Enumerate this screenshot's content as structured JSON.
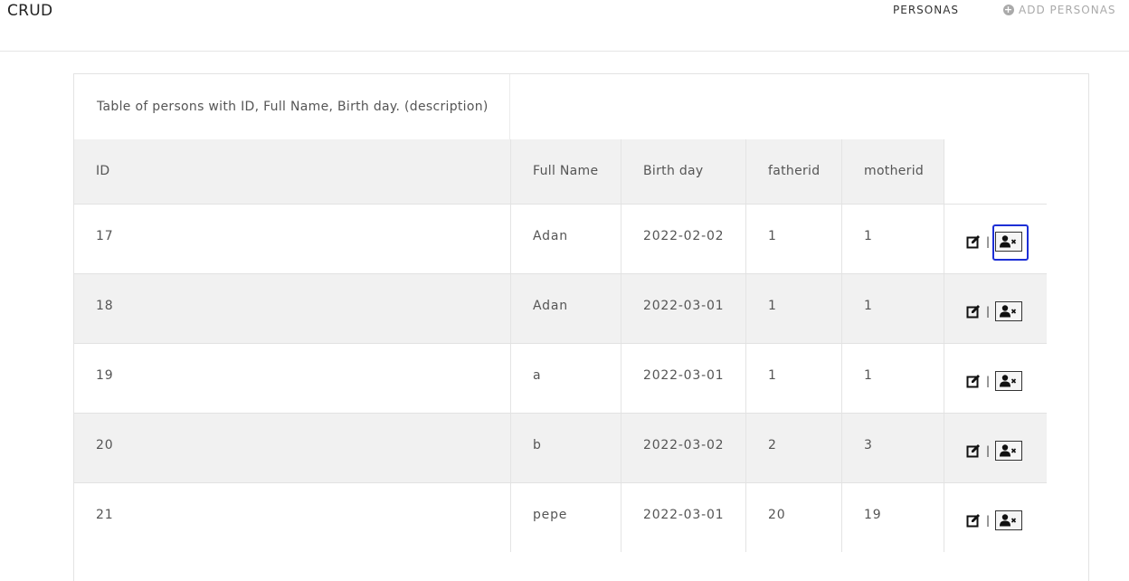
{
  "nav": {
    "brand": "CRUD",
    "personas": "PERSONAS",
    "add": "ADD PERSONAS"
  },
  "table": {
    "caption": "Table of persons with ID, Full Name, Birth day. (description)",
    "headers": {
      "id": "ID",
      "name": "Full Name",
      "birth": "Birth day",
      "father": "fatherid",
      "mother": "motherid"
    },
    "rows": [
      {
        "id": "17",
        "name": "Adan",
        "birth": "2022-02-02",
        "father": "1",
        "mother": "1"
      },
      {
        "id": "18",
        "name": "Adan",
        "birth": "2022-03-01",
        "father": "1",
        "mother": "1"
      },
      {
        "id": "19",
        "name": "a",
        "birth": "2022-03-01",
        "father": "1",
        "mother": "1"
      },
      {
        "id": "20",
        "name": "b",
        "birth": "2022-03-02",
        "father": "2",
        "mother": "3"
      },
      {
        "id": "21",
        "name": "pepe",
        "birth": "2022-03-01",
        "father": "20",
        "mother": "19"
      }
    ],
    "separator": "|"
  }
}
